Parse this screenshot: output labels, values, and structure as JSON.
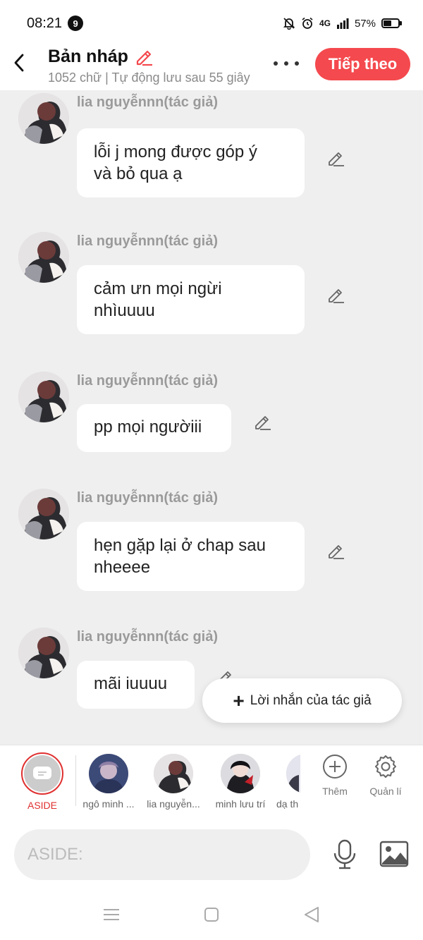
{
  "status_bar": {
    "time": "08:21",
    "notification_count": "9",
    "network": "4G",
    "battery": "57%",
    "battery_level": 0.57
  },
  "header": {
    "title": "Bản nháp",
    "subtitle": "1052 chữ | Tự động lưu sau 55 giây",
    "next_label": "Tiếp theo"
  },
  "messages": [
    {
      "author": "lia nguyễnnn(tác giả)",
      "text": "lỗi j mong được góp ý\nvà bỏ qua ạ"
    },
    {
      "author": "lia nguyễnnn(tác giả)",
      "text": "cảm ưn mọi ngừi\nnhìuuuu"
    },
    {
      "author": "lia nguyễnnn(tác giả)",
      "text": "pp mọi ngườiii"
    },
    {
      "author": "lia nguyễnnn(tác giả)",
      "text": "hẹn gặp lại ở chap sau\nnheeee"
    },
    {
      "author": "lia nguyễnnn(tác giả)",
      "text": "mãi iuuuu"
    }
  ],
  "author_note_button": "Lời nhắn của tác giả",
  "characters": {
    "aside_label": "ASIDE",
    "items": [
      {
        "label": "ngô minh ..."
      },
      {
        "label": "lia nguyễn..."
      },
      {
        "label": "minh lưu trí"
      },
      {
        "label": "dạ th"
      }
    ],
    "add_label": "Thêm",
    "manage_label": "Quản lí"
  },
  "composer": {
    "placeholder": "ASIDE:"
  },
  "colors": {
    "accent": "#f4494e",
    "background": "#efefef"
  }
}
